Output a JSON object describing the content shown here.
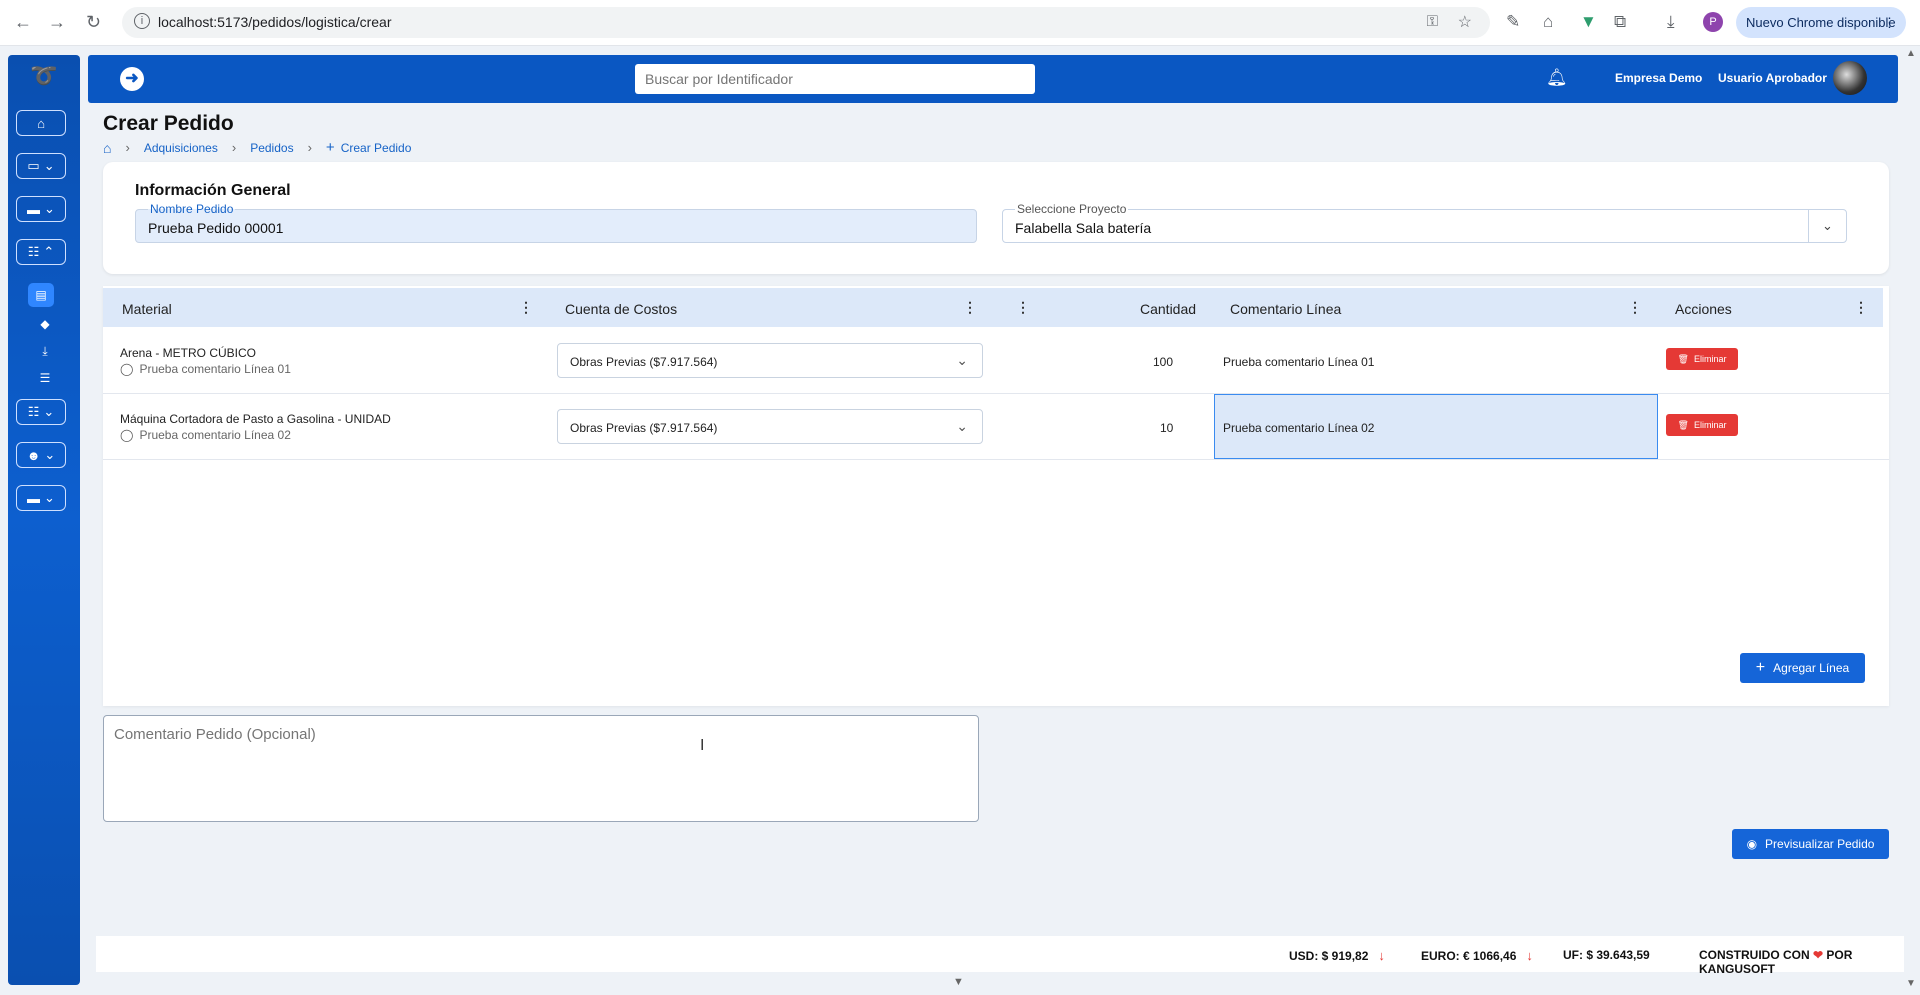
{
  "browser": {
    "url": "localhost:5173/pedidos/logistica/crear",
    "update_label": "Nuevo Chrome disponible",
    "profile_initial": "P"
  },
  "header": {
    "search_placeholder": "Buscar por Identificador",
    "company": "Empresa Demo",
    "user": "Usuario Aprobador"
  },
  "page": {
    "title": "Crear Pedido",
    "breadcrumb": [
      "Adquisiciones",
      "Pedidos",
      "Crear Pedido"
    ]
  },
  "general_info": {
    "title": "Información General",
    "order_name_label": "Nombre Pedido",
    "order_name_value": "Prueba Pedido 00001",
    "project_label": "Seleccione Proyecto",
    "project_value": "Falabella Sala batería"
  },
  "table": {
    "columns": [
      "Material",
      "Cuenta de Costos",
      "Cantidad",
      "Comentario Línea",
      "Acciones"
    ],
    "rows": [
      {
        "material": "Arena - METRO CÚBICO",
        "comment": "Prueba comentario Línea 01",
        "cost_account": "Obras Previas ($7.917.564)",
        "quantity": "100",
        "line_comment": "Prueba comentario Línea 01",
        "delete_label": "Eliminar"
      },
      {
        "material": "Máquina Cortadora de Pasto a Gasolina - UNIDAD",
        "comment": "Prueba comentario Línea 02",
        "cost_account": "Obras Previas ($7.917.564)",
        "quantity": "10",
        "line_comment": "Prueba comentario Línea 02",
        "delete_label": "Eliminar"
      }
    ],
    "add_line_label": "Agregar Línea"
  },
  "order_comment_placeholder": "Comentario Pedido (Opcional)",
  "preview_label": "Previsualizar Pedido",
  "footer": {
    "usd": "USD: $ 919,82",
    "euro": "EURO: € 1066,46",
    "uf": "UF: $ 39.643,59",
    "built_prefix": "CONSTRUIDO CON",
    "built_suffix": "POR KANGUSOFT"
  },
  "colors": {
    "primary": "#0a57c2",
    "danger": "#e53935",
    "header_row": "#dce8f9"
  }
}
